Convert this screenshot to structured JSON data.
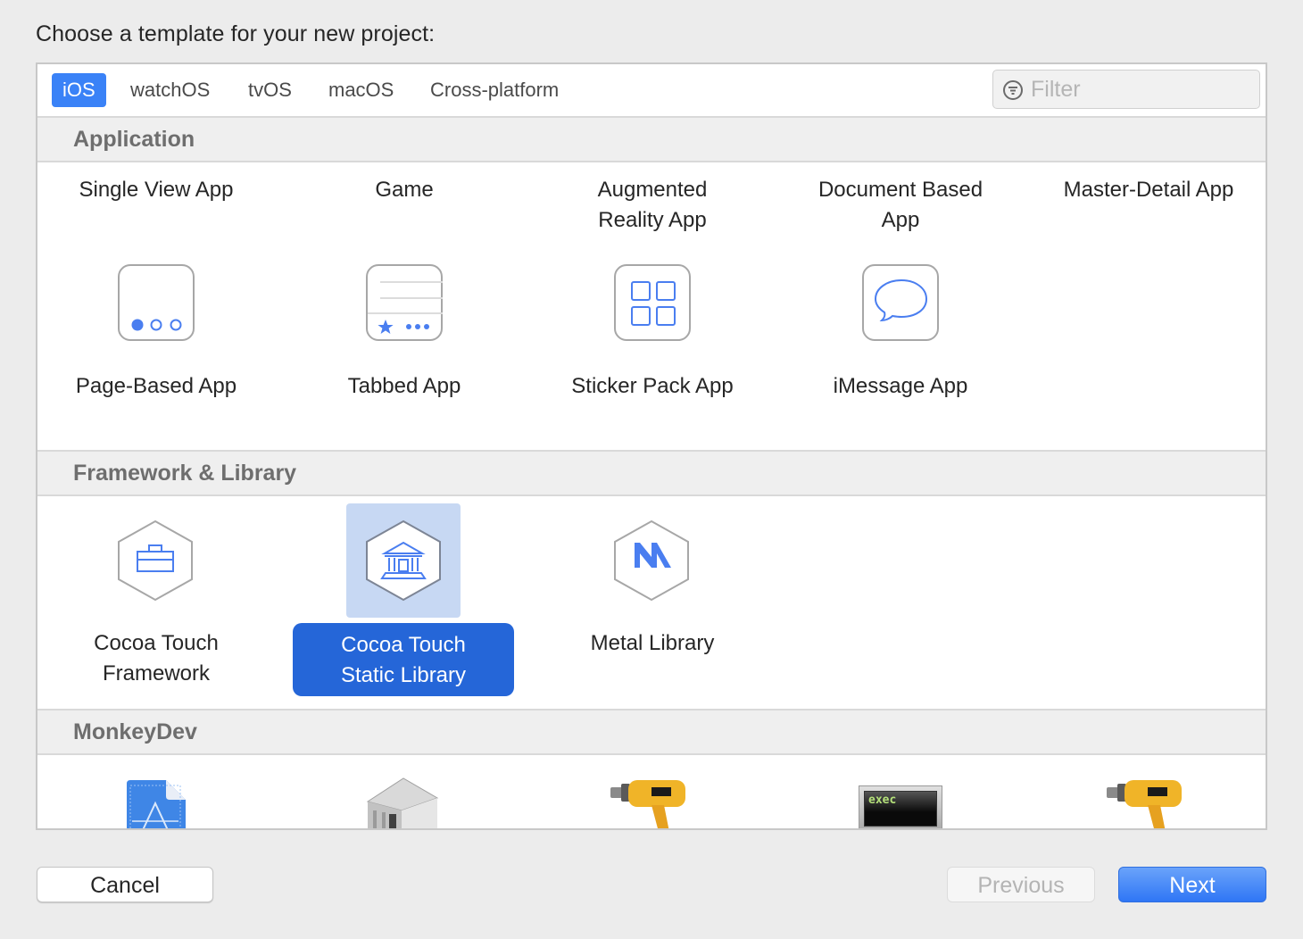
{
  "title": "Choose a template for your new project:",
  "tabs": [
    {
      "label": "iOS",
      "active": true
    },
    {
      "label": "watchOS",
      "active": false
    },
    {
      "label": "tvOS",
      "active": false
    },
    {
      "label": "macOS",
      "active": false
    },
    {
      "label": "Cross-platform",
      "active": false
    }
  ],
  "filter": {
    "placeholder": "Filter",
    "value": "",
    "icon": "filter-icon"
  },
  "sections": [
    {
      "title": "Application",
      "items": [
        {
          "label": "Single View App"
        },
        {
          "label": "Game"
        },
        {
          "label": "Augmented\nReality App"
        },
        {
          "label": "Document Based\nApp"
        },
        {
          "label": "Master-Detail App"
        },
        {
          "label": "Page-Based App",
          "icon": "page-dots-icon"
        },
        {
          "label": "Tabbed App",
          "icon": "tab-bar-icon"
        },
        {
          "label": "Sticker Pack App",
          "icon": "sticker-grid-icon"
        },
        {
          "label": "iMessage App",
          "icon": "message-bubble-icon"
        }
      ]
    },
    {
      "title": "Framework & Library",
      "items": [
        {
          "label": "Cocoa Touch\nFramework",
          "icon": "toolbox-icon"
        },
        {
          "label": "Cocoa Touch\nStatic Library",
          "icon": "library-building-icon",
          "selected": true
        },
        {
          "label": "Metal Library",
          "icon": "metal-icon"
        }
      ]
    },
    {
      "title": "MonkeyDev",
      "items": [
        {
          "icon": "app-blueprint-icon"
        },
        {
          "icon": "library-building-icon"
        },
        {
          "icon": "drill-icon"
        },
        {
          "icon": "exec-terminal-icon",
          "icon_text": "exec"
        },
        {
          "icon": "drill-icon"
        }
      ]
    }
  ],
  "buttons": {
    "cancel": "Cancel",
    "previous": "Previous",
    "next": "Next"
  },
  "colors": {
    "accent": "#3a82f7",
    "selection": "#2566d8",
    "selection_bg": "#c7d8f3",
    "icon_blue": "#4a7ef0"
  }
}
